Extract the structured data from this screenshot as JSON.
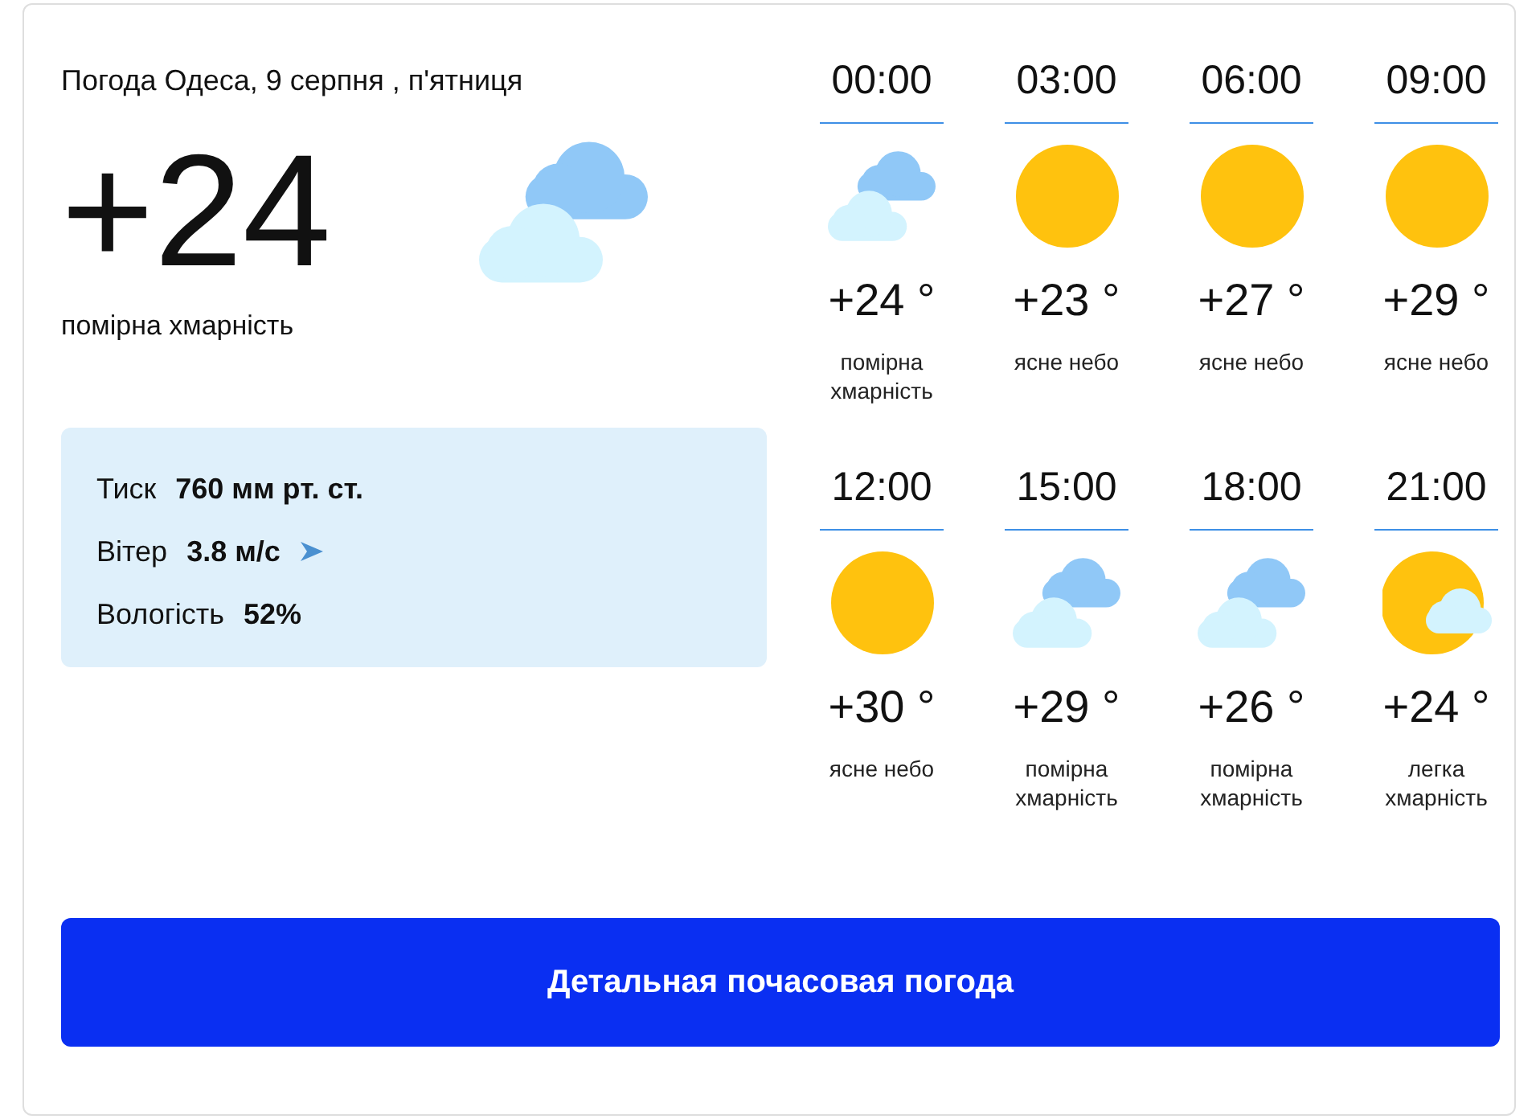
{
  "location_title": "Погода Одеса, 9 серпня , п'ятниця",
  "current": {
    "temperature": "+24",
    "kind": "clouds",
    "condition": "помірна хмарність"
  },
  "details": [
    {
      "kind": "plain",
      "label": "Тиск",
      "value": "760 мм рт. ст."
    },
    {
      "kind": "wind",
      "label": "Вітер",
      "value": "3.8 м/с"
    },
    {
      "kind": "plain",
      "label": "Вологість",
      "value": "52%"
    }
  ],
  "hourly": [
    {
      "time": "00:00",
      "kind": "clouds",
      "temperature": "+24 °",
      "condition": "помірна хмарність"
    },
    {
      "time": "03:00",
      "kind": "sun",
      "temperature": "+23 °",
      "condition": "ясне небо"
    },
    {
      "time": "06:00",
      "kind": "sun",
      "temperature": "+27 °",
      "condition": "ясне небо"
    },
    {
      "time": "09:00",
      "kind": "sun",
      "temperature": "+29 °",
      "condition": "ясне небо"
    },
    {
      "time": "12:00",
      "kind": "sun",
      "temperature": "+30 °",
      "condition": "ясне небо"
    },
    {
      "time": "15:00",
      "kind": "clouds",
      "temperature": "+29 °",
      "condition": "помірна хмарність"
    },
    {
      "time": "18:00",
      "kind": "clouds",
      "temperature": "+26 °",
      "condition": "помірна хмарність"
    },
    {
      "time": "21:00",
      "kind": "sun-cloud",
      "temperature": "+24 °",
      "condition": "легка хмарність"
    }
  ],
  "button": {
    "label": "Детальная почасовая погода"
  }
}
